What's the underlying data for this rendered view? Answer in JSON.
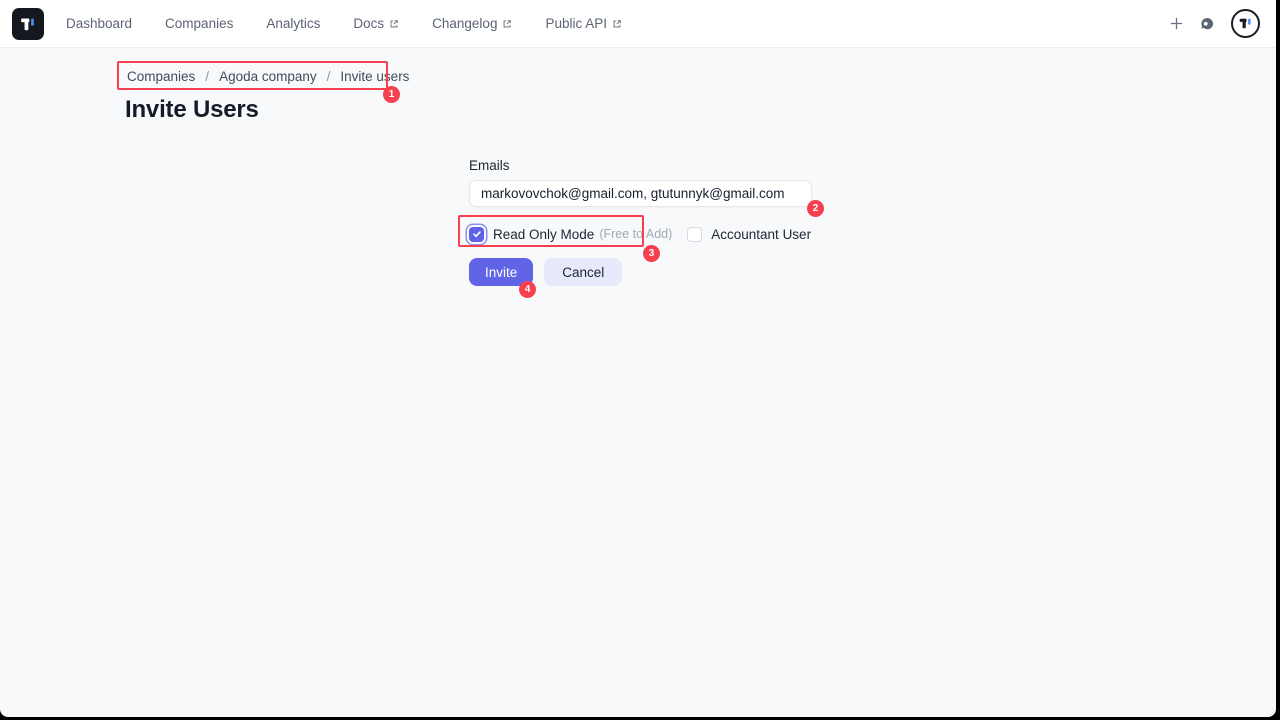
{
  "nav": {
    "brand": "T",
    "items": [
      {
        "label": "Dashboard",
        "external": false
      },
      {
        "label": "Companies",
        "external": false
      },
      {
        "label": "Analytics",
        "external": false
      },
      {
        "label": "Docs",
        "external": true
      },
      {
        "label": "Changelog",
        "external": true
      },
      {
        "label": "Public API",
        "external": true
      }
    ]
  },
  "breadcrumb": {
    "separator": "/",
    "items": [
      {
        "label": "Companies"
      },
      {
        "label": "Agoda company"
      },
      {
        "label": "Invite users"
      }
    ]
  },
  "page": {
    "title": "Invite Users"
  },
  "form": {
    "emails": {
      "label": "Emails",
      "value": "markovovchok@gmail.com, gtutunnyk@gmail.com"
    },
    "checkboxes": [
      {
        "label": "Read Only Mode",
        "hint": "(Free to Add)",
        "checked": true
      },
      {
        "label": "Accountant User",
        "hint": "",
        "checked": false
      }
    ],
    "buttons": {
      "invite": "Invite",
      "cancel": "Cancel"
    }
  },
  "annotations": [
    {
      "number": "1"
    },
    {
      "number": "2"
    },
    {
      "number": "3"
    },
    {
      "number": "4"
    }
  ],
  "colors": {
    "accent_indigo": "#6164e7",
    "annotation_red": "#f5414f",
    "brand_accent_blue": "#4a8af4",
    "page_background": "#f8f9fb"
  }
}
